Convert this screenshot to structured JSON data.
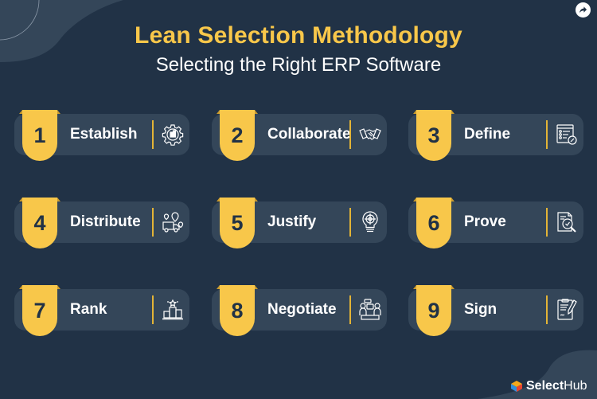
{
  "header": {
    "title": "Lean Selection Methodology",
    "subtitle": "Selecting the Right ERP Software"
  },
  "share_button": {
    "icon": "share-arrow-icon"
  },
  "colors": {
    "background": "#213246",
    "card": "#344659",
    "accent": "#f8c74a",
    "text": "#ffffff"
  },
  "steps": [
    {
      "number": "1",
      "label": "Establish",
      "icon": "gear-building-icon"
    },
    {
      "number": "2",
      "label": "Collaborate",
      "icon": "handshake-icon"
    },
    {
      "number": "3",
      "label": "Define",
      "icon": "checklist-icon"
    },
    {
      "number": "4",
      "label": "Distribute",
      "icon": "delivery-truck-location-icon"
    },
    {
      "number": "5",
      "label": "Justify",
      "icon": "lightbulb-target-icon"
    },
    {
      "number": "6",
      "label": "Prove",
      "icon": "document-magnifier-icon"
    },
    {
      "number": "7",
      "label": "Rank",
      "icon": "podium-icon"
    },
    {
      "number": "8",
      "label": "Negotiate",
      "icon": "meeting-discussion-icon"
    },
    {
      "number": "9",
      "label": "Sign",
      "icon": "contract-pen-icon"
    }
  ],
  "brand": {
    "bold": "Select",
    "regular": "Hub",
    "icon": "cube-logo-icon"
  }
}
